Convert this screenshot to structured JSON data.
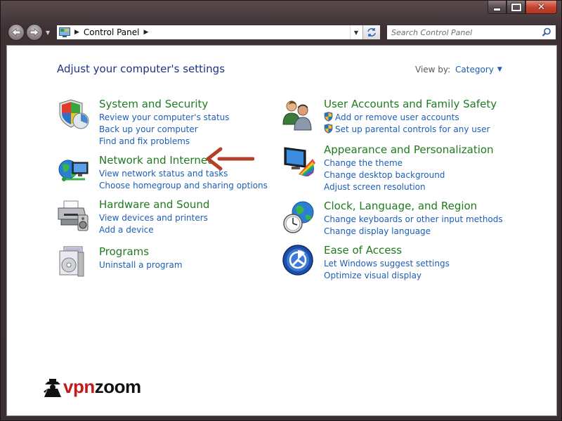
{
  "window": {
    "controls": {
      "minimize_icon": "minimize-icon",
      "maximize_icon": "maximize-icon",
      "close_icon": "close-icon"
    }
  },
  "address_bar": {
    "breadcrumb": "Control Panel",
    "icon": "control-panel-icon"
  },
  "search": {
    "placeholder": "Search Control Panel"
  },
  "main": {
    "heading": "Adjust your computer's settings",
    "view_by_label": "View by:",
    "view_by_value": "Category",
    "categories": [
      {
        "title": "System and Security",
        "icon": "shield-icon",
        "links": [
          "Review your computer's status",
          "Back up your computer",
          "Find and fix problems"
        ]
      },
      {
        "title": "Network and Internet",
        "icon": "network-globe-icon",
        "links": [
          "View network status and tasks",
          "Choose homegroup and sharing options"
        ]
      },
      {
        "title": "Hardware and Sound",
        "icon": "printer-icon",
        "links": [
          "View devices and printers",
          "Add a device"
        ]
      },
      {
        "title": "Programs",
        "icon": "programs-icon",
        "links": [
          "Uninstall a program"
        ]
      },
      {
        "title": "User Accounts and Family Safety",
        "icon": "users-icon",
        "links": [
          "Add or remove user accounts",
          "Set up parental controls for any user"
        ]
      },
      {
        "title": "Appearance and Personalization",
        "icon": "monitor-palette-icon",
        "links": [
          "Change the theme",
          "Change desktop background",
          "Adjust screen resolution"
        ]
      },
      {
        "title": "Clock, Language, and Region",
        "icon": "clock-globe-icon",
        "links": [
          "Change keyboards or other input methods",
          "Change display language"
        ]
      },
      {
        "title": "Ease of Access",
        "icon": "ease-of-access-icon",
        "links": [
          "Let Windows suggest settings",
          "Optimize visual display"
        ]
      }
    ]
  },
  "annotation": {
    "arrow_color": "#c0392b"
  },
  "watermark": {
    "text_prefix": "vpn",
    "text_suffix": "zoom"
  },
  "colors": {
    "link": "#1c5fb4",
    "category_title": "#1e7b1e",
    "heading": "#1e3287"
  }
}
